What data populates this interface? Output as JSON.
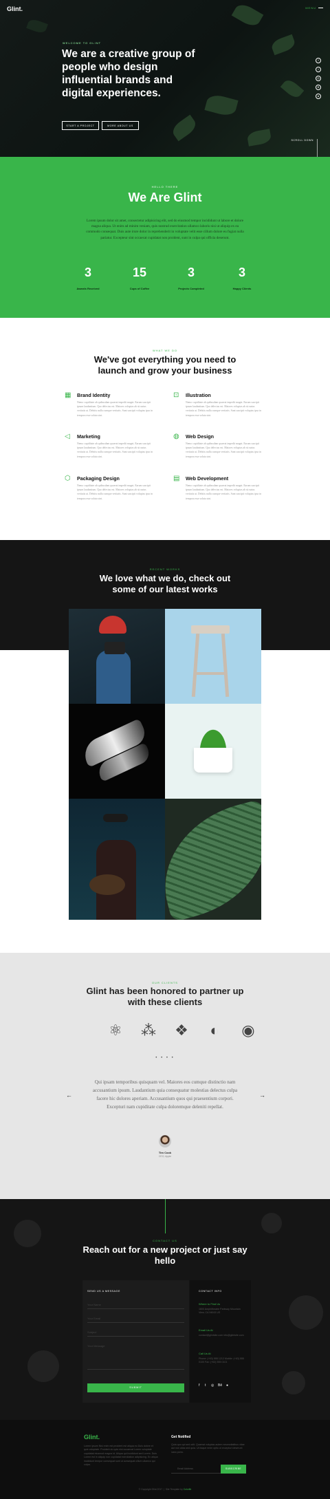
{
  "header": {
    "logo": "Glint.",
    "menu_label": "MENU"
  },
  "hero": {
    "kicker": "WELCOME TO GLINT",
    "headline": "We are a creative group of people who design influential brands and digital experiences.",
    "btn_start": "START A PROJECT",
    "btn_more": "MORE ABOUT US",
    "social": [
      "facebook-icon",
      "twitter-icon",
      "instagram-icon",
      "behance-icon",
      "dribbble-icon"
    ],
    "scroll_label": "SCROLL DOWN"
  },
  "about": {
    "kicker": "HELLO THERE",
    "title": "We Are Glint",
    "lead": "Lorem ipsum dolor sit amet, consectetur adipisicing elit, sed do eiusmod tempor incididunt ut labore et dolore magna aliqua. Ut enim ad minim veniam, quis nostrud exercitation ullamco laboris nisi ut aliquip ex ea commodo consequat. Duis aute irure dolor in reprehenderit in voluptate velit esse cillum dolore eu fugiat nulla pariatur. Excepteur sint occaecat cupidatat non proident, sunt in culpa qui officia deserunt.",
    "stats": [
      {
        "num": "3",
        "label": "Awards Received"
      },
      {
        "num": "15",
        "label": "Cups of Coffee"
      },
      {
        "num": "3",
        "label": "Projects Completed"
      },
      {
        "num": "3",
        "label": "Happy Clients"
      }
    ]
  },
  "services": {
    "kicker": "WHAT WE DO",
    "title": "We've got everything you need to launch and grow your business",
    "body": "Nemo cupiditate ab quibusdam quaerat impedit magni. Earum suscipit ipsum laudantium. Quo delectus est. Maiores voluptas ab sit natus veritatis ut. Debitis nulla cumque veritatis. Sunt suscipit voluptas ipsa in tempora esse soluta sint.",
    "items": [
      {
        "icon": "paint-brush-icon",
        "title": "Brand Identity"
      },
      {
        "icon": "group-icon",
        "title": "Illustration"
      },
      {
        "icon": "megaphone-icon",
        "title": "Marketing"
      },
      {
        "icon": "earth-icon",
        "title": "Web Design"
      },
      {
        "icon": "cube-icon",
        "title": "Packaging Design"
      },
      {
        "icon": "window-icon",
        "title": "Web Development"
      }
    ]
  },
  "works": {
    "kicker": "RECENT WORKS",
    "title": "We love what we do, check out some of our latest works"
  },
  "clients": {
    "kicker": "OUR CLIENTS",
    "title": "Glint has been honored to partner up with these clients",
    "logos": [
      "apple-icon",
      "atom-icon",
      "blackberry-icon",
      "dropbox-icon",
      "envato-icon",
      "firefox-icon"
    ],
    "dots": "• • • •",
    "quote": "Qui ipsam temporibus quisquam vel. Maiores eos cumque distinctio nam accusantium ipsum. Laudantium quia consequatur molestias delectus culpa facere hic dolores aperiam. Accusantium quos qui praesentium corpori. Excepturi nam cupiditate culpa doloremque deleniti repellat.",
    "author": "Tim Cook",
    "role": "CEO, Apple",
    "prev": "←",
    "next": "→"
  },
  "contact": {
    "kicker": "CONTACT US",
    "title": "Reach out for a new project or just say hello",
    "form_title": "SEND US A MESSAGE",
    "fields": [
      "Your Name",
      "Your Email",
      "Subject",
      "Your Message"
    ],
    "submit": "SUBMIT",
    "info_title": "CONTACT INFO",
    "where_label": "Where to Find Us",
    "where_text": "1600 Amphitheatre Parkway Mountain View, CA 94043 US",
    "email_label": "Email Us At",
    "email_text": "contact@glintsite.com info@glintsite.com",
    "call_label": "Call Us At",
    "call_text": "Phone: (+63) 555 1212 Mobile: (+63) 555 0100 Fax: (+63) 555 0101",
    "social": [
      "f",
      "t",
      "◎",
      "Bē",
      "●"
    ]
  },
  "footer": {
    "logo": "Glint.",
    "text": "Lorem ipsum Nisi enim est proident est aliqua eu Duis dolore et quis voluptate. Proident do quis nisi occaecat Lorem voluptate cupidatat eiusmod magna id. Aliqua qui incididunt sed Lorem. Duis Lorem est in aliquip non cupidatat exercitation adipisicing. Ex aliqua incididunt tempor consequat sunt ut consequat cillum ullamco qui culpa.",
    "newsletter_title": "Get Notified",
    "newsletter_text": "Quia quo qui sed odit. Quaerat voluptas autem necessitatibus vitae aut non alias sed quia. Ut itaque enim optio ut excepturi deserunt iusto porro.",
    "email_placeholder": "Email Address",
    "subscribe": "SUBSCRIBE",
    "copyright": "© Copyright Glint 2017",
    "site_template_by": "Site Template by",
    "site_template_link": "Colorlib"
  }
}
